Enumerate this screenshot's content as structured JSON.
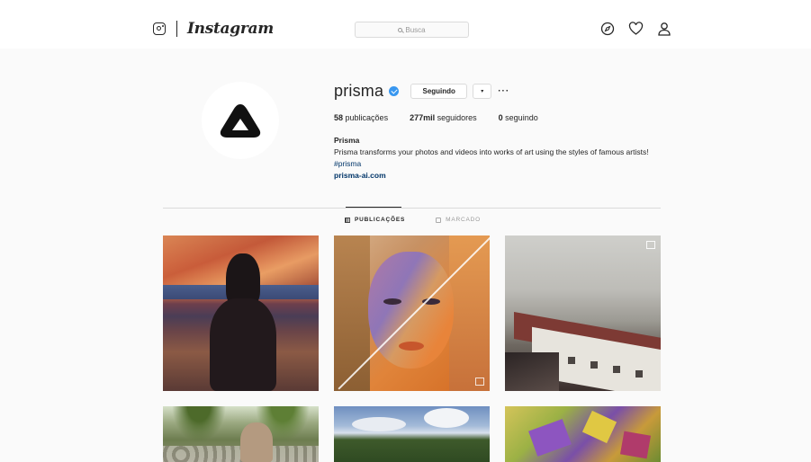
{
  "header": {
    "brand_word": "Instagram",
    "search_placeholder": "Busca",
    "icons": [
      "compass-icon",
      "heart-icon",
      "user-icon"
    ]
  },
  "profile": {
    "username": "prisma",
    "verified": true,
    "follow_label": "Seguindo",
    "dropdown_label": "▾",
    "more_label": "···",
    "stats": {
      "posts_count": "58",
      "posts_label": "publicações",
      "followers_count": "277mil",
      "followers_label": "seguidores",
      "following_count": "0",
      "following_label": "seguindo"
    },
    "full_name": "Prisma",
    "bio_text": "Prisma transforms your photos and videos into works of art using the styles of famous artists! ",
    "bio_hashtag": "#prisma",
    "website": "prisma-ai.com"
  },
  "tabs": [
    {
      "label": "PUBLICAÇÕES",
      "active": true
    },
    {
      "label": "MARCADO",
      "active": false
    }
  ],
  "colors": {
    "accent": "#3897f0",
    "link": "#003569",
    "border": "#dbdbdb",
    "text": "#262626",
    "background": "#fafafa"
  }
}
